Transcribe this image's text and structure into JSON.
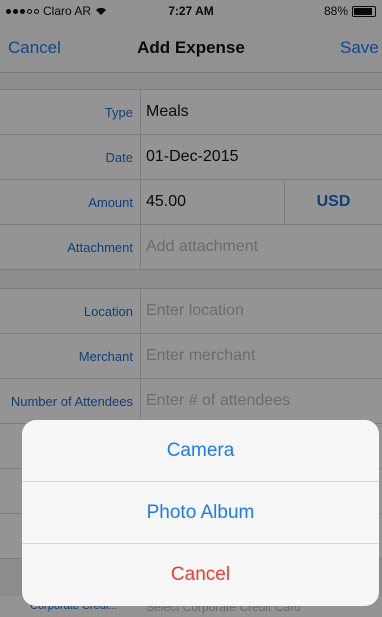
{
  "status_bar": {
    "carrier": "Claro AR",
    "time": "7:27 AM",
    "battery": "88%",
    "battery_level": 0.88
  },
  "nav": {
    "cancel_label": "Cancel",
    "title": "Add Expense",
    "save_label": "Save"
  },
  "form": {
    "type": {
      "label": "Type",
      "value": "Meals"
    },
    "date": {
      "label": "Date",
      "value": "01-Dec-2015"
    },
    "amount": {
      "label": "Amount",
      "value": "45.00",
      "currency": "USD"
    },
    "attachment": {
      "label": "Attachment",
      "placeholder": "Add attachment"
    },
    "location": {
      "label": "Location",
      "placeholder": "Enter location"
    },
    "merchant": {
      "label": "Merchant",
      "placeholder": "Enter merchant"
    },
    "attendees": {
      "label": "Number of Attendees",
      "placeholder": "Enter # of attendees"
    },
    "corporate_card": {
      "label": "Corporate Credi...",
      "placeholder": "Select Corporate Credit Card"
    }
  },
  "action_sheet": {
    "camera_label": "Camera",
    "photo_album_label": "Photo Album",
    "cancel_label": "Cancel"
  },
  "colors": {
    "accent": "#1a7cf5",
    "destructive": "#f23a2f"
  }
}
